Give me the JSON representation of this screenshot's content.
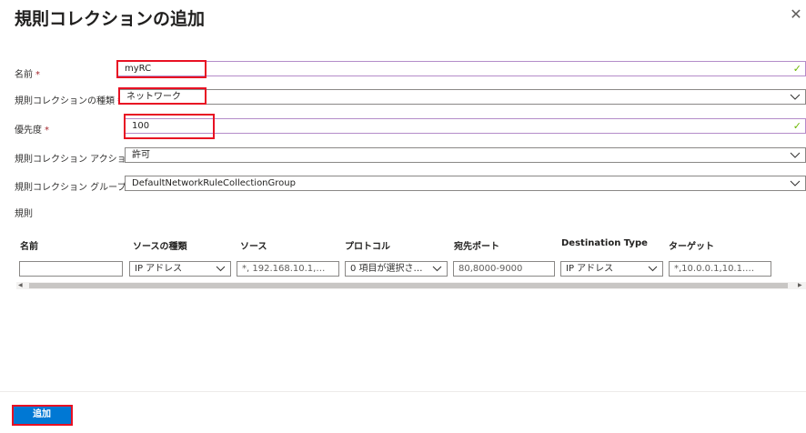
{
  "panel": {
    "title": "規則コレクションの追加"
  },
  "form": {
    "name_label": "名前",
    "name_value": "myRC",
    "type_label": "規則コレクションの種類",
    "type_value": "ネットワーク",
    "priority_label": "優先度",
    "priority_value": "100",
    "action_label": "規則コレクション アクション",
    "action_value": "許可",
    "group_label": "規則コレクション グループ",
    "group_value": "DefaultNetworkRuleCollectionGroup",
    "required_marker": "*",
    "valid_mark": "✓"
  },
  "rules": {
    "section_label": "規則",
    "headers": {
      "name": "名前",
      "source_type": "ソースの種類",
      "source": "ソース",
      "protocol": "プロトコル",
      "dest_port": "宛先ポート",
      "dest_type": "Destination Type",
      "target": "ターゲット"
    },
    "row": {
      "name": "",
      "source_type": "IP アドレス",
      "source": "*, 192.168.10.1,…",
      "protocol": "0 項目が選択さ…",
      "dest_port": "80,8000-9000",
      "dest_type": "IP アドレス",
      "target": "*,10.0.0.1,10.1.…"
    }
  },
  "footer": {
    "add_button": "追加"
  },
  "colors": {
    "accent": "#0078d4",
    "highlight": "#e81123",
    "valid": "#6bb700"
  },
  "icons": {
    "close": "close-icon",
    "chevron": "chevron-down-icon",
    "check": "checkmark-icon"
  }
}
